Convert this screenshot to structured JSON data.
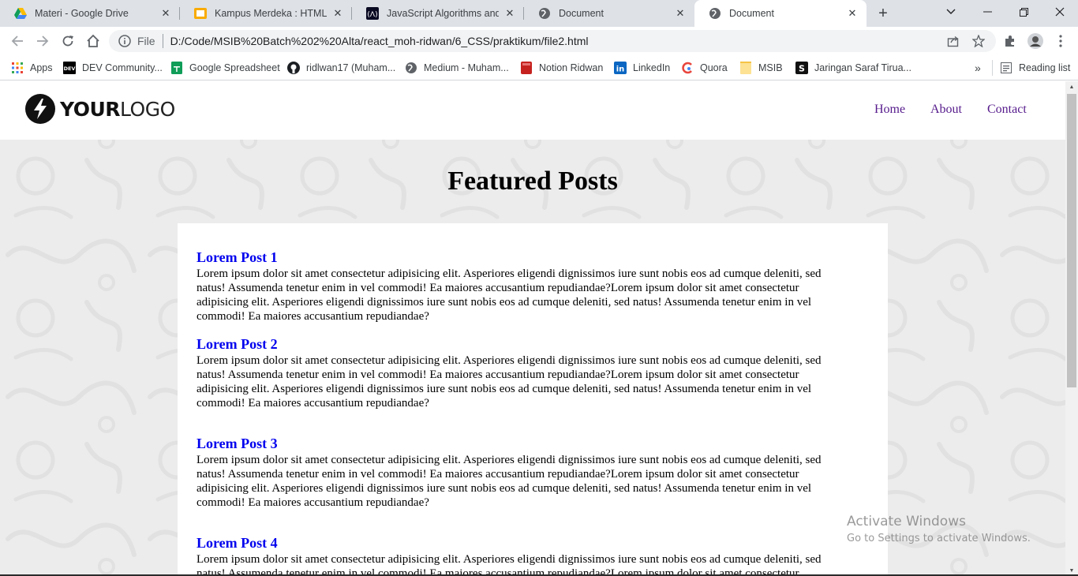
{
  "tabs": [
    {
      "title": "Materi - Google Drive",
      "icon": "google-drive-icon"
    },
    {
      "title": "Kampus Merdeka : HTML & CSS",
      "icon": "kampus-merdeka-icon"
    },
    {
      "title": "JavaScript Algorithms and Data",
      "icon": "freecodecamp-icon"
    },
    {
      "title": "Document",
      "icon": "globe-icon"
    },
    {
      "title": "Document",
      "icon": "globe-icon",
      "active": true
    }
  ],
  "address": {
    "scheme_label": "File",
    "url": "D:/Code/MSIB%20Batch%202%20Alta/react_moh-ridwan/6_CSS/praktikum/file2.html"
  },
  "bookmarks": [
    {
      "label": "Apps",
      "icon": "apps-grid-icon"
    },
    {
      "label": "DEV Community...",
      "icon": "dev-icon"
    },
    {
      "label": "Google Spreadsheet",
      "icon": "google-sheets-icon"
    },
    {
      "label": "ridlwan17 (Muham...",
      "icon": "github-icon"
    },
    {
      "label": "Medium - Muham...",
      "icon": "globe-icon"
    },
    {
      "label": "Notion Ridwan",
      "icon": "notion-icon"
    },
    {
      "label": "LinkedIn",
      "icon": "linkedin-icon"
    },
    {
      "label": "Quora",
      "icon": "quora-icon"
    },
    {
      "label": "MSIB",
      "icon": "folder-icon"
    },
    {
      "label": "Jaringan Saraf Tirua...",
      "icon": "s-icon"
    }
  ],
  "bookmarks_overflow": "»",
  "reading_list": "Reading list",
  "site": {
    "logo_bold": "YOUR",
    "logo_light": "LOGO",
    "nav": [
      "Home",
      "About",
      "Contact"
    ],
    "heading": "Featured Posts",
    "posts": [
      {
        "title": "Lorem Post 1",
        "lines": [
          "Lorem ipsum dolor sit amet consectetur adipisicing elit. Asperiores eligendi dignissimos iure sunt nobis eos ad cumque deleniti, sed",
          "natus! Assumenda tenetur enim in vel commodi! Ea maiores accusantium repudiandae?Lorem ipsum dolor sit amet consectetur",
          "adipisicing elit. Asperiores eligendi dignissimos iure sunt nobis eos ad cumque deleniti, sed natus! Assumenda tenetur enim in vel",
          "commodi! Ea maiores accusantium repudiandae?"
        ]
      },
      {
        "title": "Lorem Post 2",
        "lines": [
          "Lorem ipsum dolor sit amet consectetur adipisicing elit. Asperiores eligendi dignissimos iure sunt nobis eos ad cumque deleniti, sed",
          "natus! Assumenda tenetur enim in vel commodi! Ea maiores accusantium repudiandae?Lorem ipsum dolor sit amet consectetur",
          "adipisicing elit. Asperiores eligendi dignissimos iure sunt nobis eos ad cumque deleniti, sed natus! Assumenda tenetur enim in vel",
          "commodi! Ea maiores accusantium repudiandae?"
        ]
      },
      {
        "title": "Lorem Post 3",
        "lines": [
          "Lorem ipsum dolor sit amet consectetur adipisicing elit. Asperiores eligendi dignissimos iure sunt nobis eos ad cumque deleniti, sed",
          "natus! Assumenda tenetur enim in vel commodi! Ea maiores accusantium repudiandae?Lorem ipsum dolor sit amet consectetur",
          "adipisicing elit. Asperiores eligendi dignissimos iure sunt nobis eos ad cumque deleniti, sed natus! Assumenda tenetur enim in vel",
          "commodi! Ea maiores accusantium repudiandae?"
        ]
      },
      {
        "title": "Lorem Post 4",
        "lines": [
          "Lorem ipsum dolor sit amet consectetur adipisicing elit. Asperiores eligendi dignissimos iure sunt nobis eos ad cumque deleniti, sed",
          "natus! Assumenda tenetur enim in vel commodi! Ea maiores accusantium repudiandae?Lorem ipsum dolor sit amet consectetur"
        ]
      }
    ]
  },
  "watermark": {
    "line1": "Activate Windows",
    "line2": "Go to Settings to activate Windows."
  },
  "colors": {
    "post_title": "#0000ee",
    "nav_link": "#551a8b",
    "page_background": "#ececec"
  }
}
